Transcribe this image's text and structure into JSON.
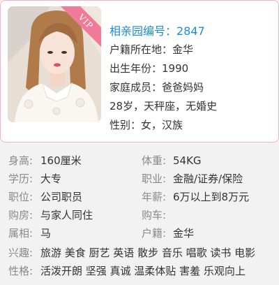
{
  "card": {
    "badge": "VIP",
    "title_prefix": "相亲园编号：",
    "id_number": "2847",
    "lines": [
      "户籍所在地：金华",
      "出生年份：1990",
      "家庭成员：爸爸妈妈",
      "28岁，天秤座，无婚史",
      "性别：女，汉族"
    ]
  },
  "details": {
    "height": {
      "label": "身高:",
      "value": "160厘米"
    },
    "weight": {
      "label": "体重:",
      "value": "54KG"
    },
    "education": {
      "label": "学历:",
      "value": "大专"
    },
    "occupation": {
      "label": "职业:",
      "value": "金融/证券/保险"
    },
    "position": {
      "label": "职位:",
      "value": "公司职员"
    },
    "salary": {
      "label": "年薪:",
      "value": "6万以上到8万元"
    },
    "housing": {
      "label": "购房:",
      "value": "与家人同住"
    },
    "car": {
      "label": "购车:",
      "value": ""
    },
    "zodiac": {
      "label": "属相:",
      "value": "马"
    },
    "hukou": {
      "label": "户籍:",
      "value": "金华"
    },
    "hobbies": {
      "label": "兴趣:",
      "value": "旅游 美食 厨艺 英语 散步 音乐 唱歌 读书 电影"
    },
    "personality": {
      "label": "性格:",
      "value": "活泼开朗 坚强 真诚 温柔体贴 害羞 乐观向上"
    }
  },
  "colors": {
    "accent_blue": "#1a8cd8",
    "vip_pink": "#f07a9a",
    "card_border": "#f4b3c9",
    "label_gray": "#8a8a8a",
    "text": "#333333",
    "background": "#f2f2f2"
  }
}
